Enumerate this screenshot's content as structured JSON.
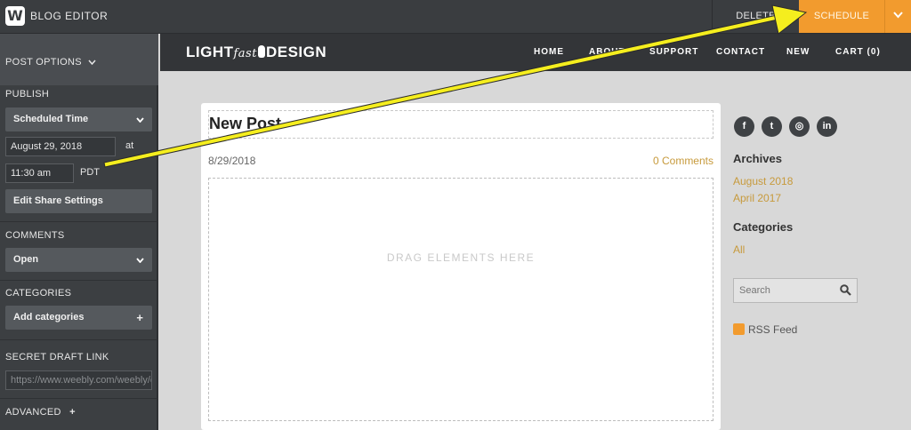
{
  "topbar": {
    "logo_letter": "W",
    "title": "BLOG EDITOR",
    "delete_label": "DELETE",
    "schedule_label": "SCHEDULE"
  },
  "sidebar": {
    "post_options_label": "POST OPTIONS",
    "publish": {
      "label": "PUBLISH",
      "mode_value": "Scheduled Time",
      "date_value": "August 29, 2018",
      "at_label": "at",
      "time_value": "11:30 am",
      "timezone": "PDT",
      "share_settings_label": "Edit Share Settings"
    },
    "comments": {
      "label": "COMMENTS",
      "value": "Open"
    },
    "categories": {
      "label": "CATEGORIES",
      "add_label": "Add categories"
    },
    "secret_draft": {
      "label": "SECRET DRAFT LINK",
      "url": "https://www.weebly.com/weebly/c"
    },
    "advanced_label": "ADVANCED"
  },
  "site": {
    "brand_left": "LIGHT",
    "brand_mid": "fast",
    "brand_right": "DESIGN",
    "nav": [
      "HOME",
      "ABOUT",
      "SUPPORT",
      "CONTACT",
      "NEW",
      "CART (0)"
    ]
  },
  "post": {
    "title": "New Post",
    "date": "8/29/2018",
    "comments": "0 Comments",
    "drop_text": "DRAG ELEMENTS HERE"
  },
  "side": {
    "social_icons": [
      "facebook-icon",
      "twitter-icon",
      "instagram-icon",
      "linkedin-icon"
    ],
    "social_glyphs": [
      "f",
      "t",
      "◎",
      "in"
    ],
    "archives_heading": "Archives",
    "archives": [
      "August 2018",
      "April 2017"
    ],
    "categories_heading": "Categories",
    "categories": [
      "All"
    ],
    "search_placeholder": "Search",
    "rss_label": "RSS Feed"
  },
  "colors": {
    "accent": "#f29b2e",
    "link": "#c79a3c",
    "annotation_arrow": "#f5ee1e"
  }
}
